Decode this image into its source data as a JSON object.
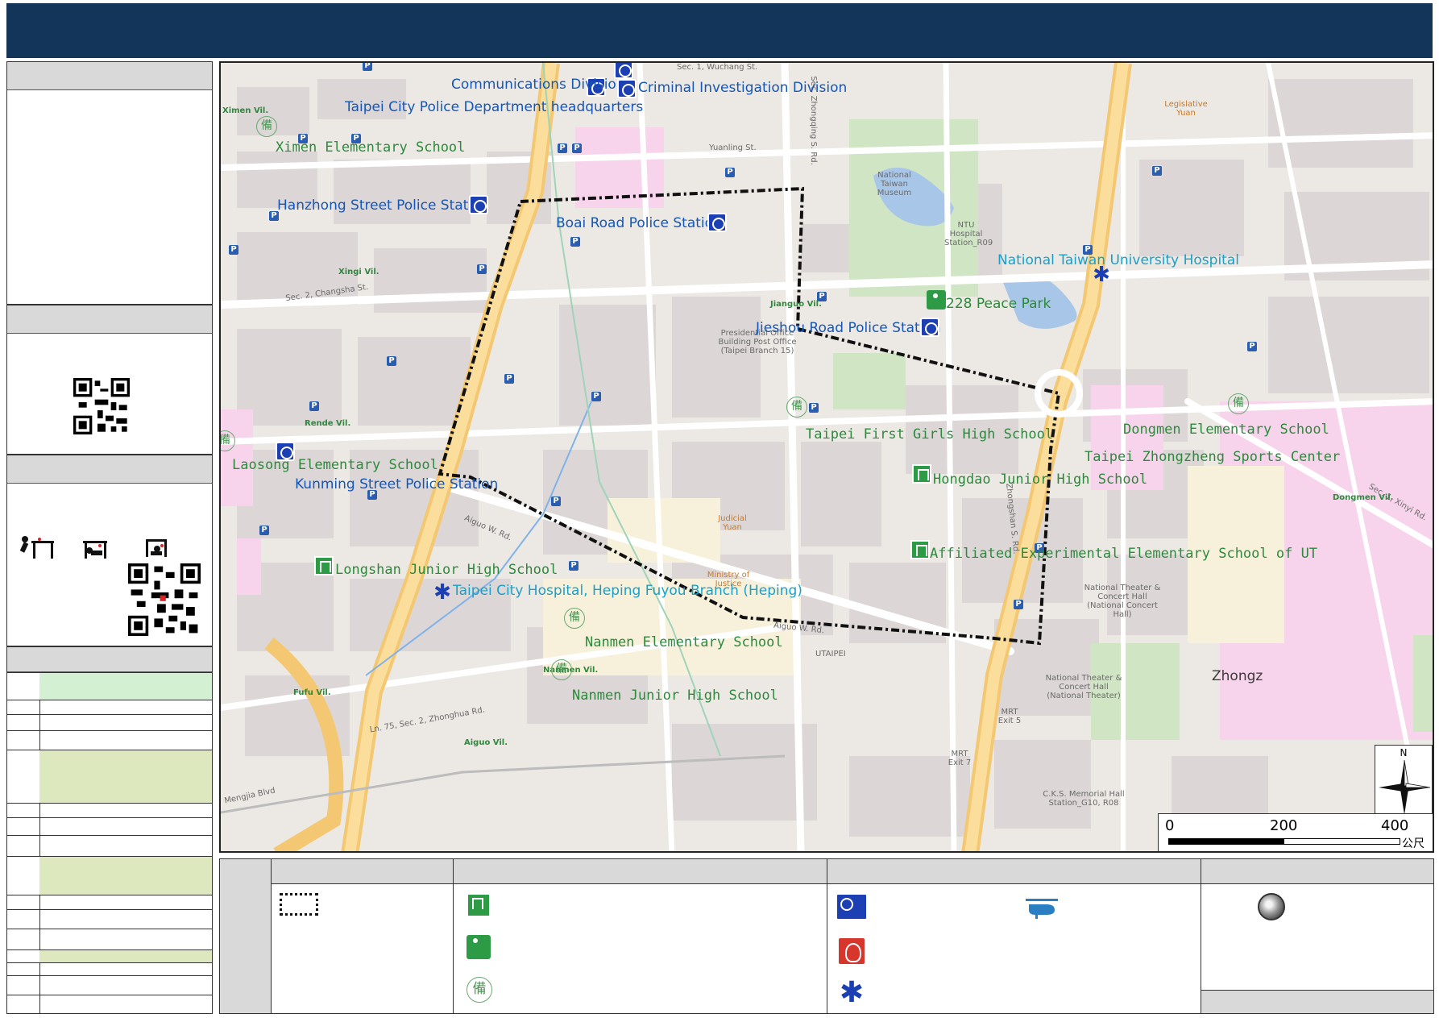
{
  "colors": {
    "title_bar": "#13355a",
    "header_grey": "#d9d9d9",
    "evac_boundary": "#111111",
    "table_green_light": "#d3f0d2",
    "table_green_olive": "#dde8be",
    "police_blue": "#1c3fb4",
    "school_green": "#2d8a3c",
    "hospital_teal": "#1aa0c8"
  },
  "icons": {
    "evac_boundary": "dotted-rectangle-icon",
    "shelter": "shelter-house-icon",
    "park": "park-runner-icon",
    "reserve": "bei-reserve-icon",
    "police": "police-badge-icon",
    "fire": "fire-badge-icon",
    "hospital": "star-of-life-icon",
    "helipad": "helicopter-icon",
    "assembly": "assembly-point-icon"
  },
  "map": {
    "poi_labels": {
      "comm_div": "Communications Division",
      "cid": "Criminal Investigation Division",
      "tcpd_hq": "Taipei City Police Department headquarters",
      "ximen_es": "Ximen Elementary School",
      "hanzhong_ps": "Hanzhong Street Police Station",
      "boai_ps": "Boai Road Police Station",
      "ntuh": "National Taiwan University Hospital",
      "peace_park": "228 Peace Park",
      "jieshou_ps": "Jieshou Road Police Station",
      "first_girls": "Taipei First Girls High School",
      "dongmen_es": "Dongmen Elementary School",
      "zhongzheng_sports": "Taipei Zhongzheng Sports Center",
      "laosong_es": "Laosong Elementary School",
      "kunming_ps": "Kunming Street Police Station",
      "hongdao_jhs": "Hongdao Junior High School",
      "longshan_jhs": "Longshan Junior High School",
      "heping_fuyou": "Taipei City Hospital, Heping Fuyou Branch (Heping)",
      "affiliated_ut": "Affiliated Experimental Elementary School of UT",
      "nanmen_es": "Nanmen Elementary School",
      "nanmen_jhs": "Nanmen Junior High School"
    },
    "base_labels": {
      "wuchang": "Sec. 1, Wuchang St.",
      "changsha": "Sec. 2, Changsha St.",
      "aiguo_w1": "Aiguo W. Rd.",
      "aiguo_w2": "Aiguo W. Rd.",
      "yuanling": "Yuanling St.",
      "zhongshan_s": "Zhongshan S. Rd.",
      "zhongqing": "Sec. Zhongqing S. Rd.",
      "zhonghua": "Ln. 75, Sec. 2, Zhonghua Rd.",
      "mengjia": "Mengjia Blvd",
      "xinyi": "Sec. 1, Xinyi Rd.",
      "ximen_vil": "Ximen Vil.",
      "xingi_vil": "Xingi Vil.",
      "jianguo_vil": "Jianguo Vil.",
      "rende_vil": "Rende Vil.",
      "nanmen_vil": "Nanmen Vil.",
      "aiguo_vil": "Aiguo Vil.",
      "fufu_vil": "Fufu Vil.",
      "dongmen_vil": "Dongmen Vil.",
      "legislative": "Legislative Yuan",
      "ntm": "National Taiwan Museum",
      "presidential": "Presidential Office Building Post Office (Taipei Branch 15)",
      "judicial": "Judicial Yuan",
      "moj": "Ministry of Justice",
      "utaipei": "UTAIPEI",
      "ntch": "National Theater & Concert Hall (National Theater)",
      "ncc": "National Theater & Concert Hall (National Concert Hall)",
      "cks": "C.K.S. Memorial Hall Station_G10, R08",
      "ntuh_station": "NTU Hospital Station_R09",
      "zhongzheng_big": "Zhongz",
      "mrt_exit5": "MRT Exit 5",
      "mrt_exit7": "MRT Exit 7"
    },
    "scale": {
      "zero": "0",
      "mid": "200",
      "max": "400",
      "unit": "公尺"
    },
    "compass_north": "N"
  }
}
